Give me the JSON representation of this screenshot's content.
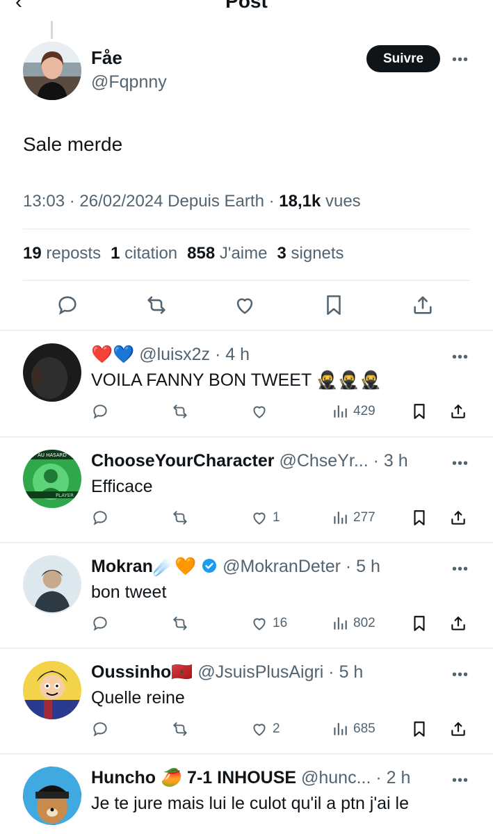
{
  "header": {
    "back_glyph": "‹",
    "title": "Post"
  },
  "post": {
    "author_name": "Fåe",
    "author_handle": "@Fqpnny",
    "follow_label": "Suivre",
    "more_label": "•••",
    "text": "Sale merde",
    "meta_time": "13:03 · 26/02/2024 Depuis Earth · ",
    "meta_views_count": "18,1k",
    "meta_views_label": " vues",
    "stats": {
      "reposts_count": "19",
      "reposts_label": "reposts",
      "quotes_count": "1",
      "quotes_label": "citation",
      "likes_count": "858",
      "likes_label": "J'aime",
      "bookmarks_count": "3",
      "bookmarks_label": "signets"
    }
  },
  "replies": [
    {
      "name": "",
      "emoji_prefix": "❤️💙",
      "handle_time": "@luisx2z · 4 h",
      "text": "VOILA FANNY BON TWEET 🥷🥷🥷",
      "likes": "",
      "views": "429"
    },
    {
      "name": "ChooseYourCharacter",
      "emoji_prefix": "",
      "handle_time": "@ChseYr... · 3 h",
      "text": "Efficace",
      "likes": "1",
      "views": "277",
      "avatar_label_top": "AU HASARD",
      "avatar_label_bottom": "PLAYER"
    },
    {
      "name": "Mokran☄️🧡",
      "emoji_prefix": "",
      "handle_time": "@MokranDeter · 5 h",
      "text": "bon tweet",
      "likes": "16",
      "views": "802"
    },
    {
      "name": "Oussinho🇲🇦",
      "emoji_prefix": "",
      "handle_time": "@JsuisPlusAigri · 5 h",
      "text": "Quelle reine",
      "likes": "2",
      "views": "685"
    },
    {
      "name": "Huncho 🥭 7-1 INHOUSE",
      "emoji_prefix": "",
      "handle_time": "@hunc... · 2 h",
      "text": "Je te jure mais lui le culot qu'il a ptn j'ai le"
    }
  ],
  "colors": {
    "text": "#0f1419",
    "secondary": "#536471",
    "divider": "#e1e8ed",
    "verified": "#1d9bf0",
    "follow_bg": "#0f1419"
  },
  "icons": [
    "back-icon",
    "reply-icon",
    "repost-icon",
    "like-icon",
    "bookmark-icon",
    "share-icon",
    "views-icon",
    "verified-badge-icon",
    "more-icon"
  ]
}
